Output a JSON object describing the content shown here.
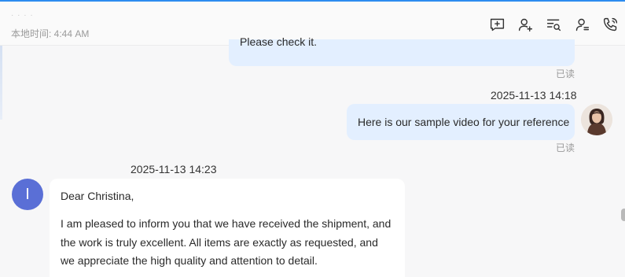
{
  "header": {
    "faded_text": "· · · ·",
    "local_time": "本地时间: 4:44 AM",
    "icons": [
      "add-comment-icon",
      "add-contact-icon",
      "search-history-icon",
      "contact-settings-icon",
      "call-icon"
    ]
  },
  "messages": [
    {
      "direction": "outgoing",
      "text": "Please check it.",
      "status": "已读"
    },
    {
      "direction": "outgoing",
      "timestamp": "2025-11-13 14:18",
      "text": "Here is our sample video for your reference",
      "status": "已读"
    },
    {
      "direction": "incoming",
      "timestamp": "2025-11-13 14:23",
      "avatar_initial": "I",
      "greeting": "Dear Christina,",
      "body": "I am pleased to inform you that we have received the shipment, and the work is truly excellent. All items are exactly as requested, and we appreciate the high quality and attention to detail."
    }
  ],
  "colors": {
    "accent": "#2d8cf0",
    "outgoing_bubble": "#e3efff",
    "incoming_bubble": "#ffffff",
    "incoming_avatar": "#5a6fd6"
  }
}
